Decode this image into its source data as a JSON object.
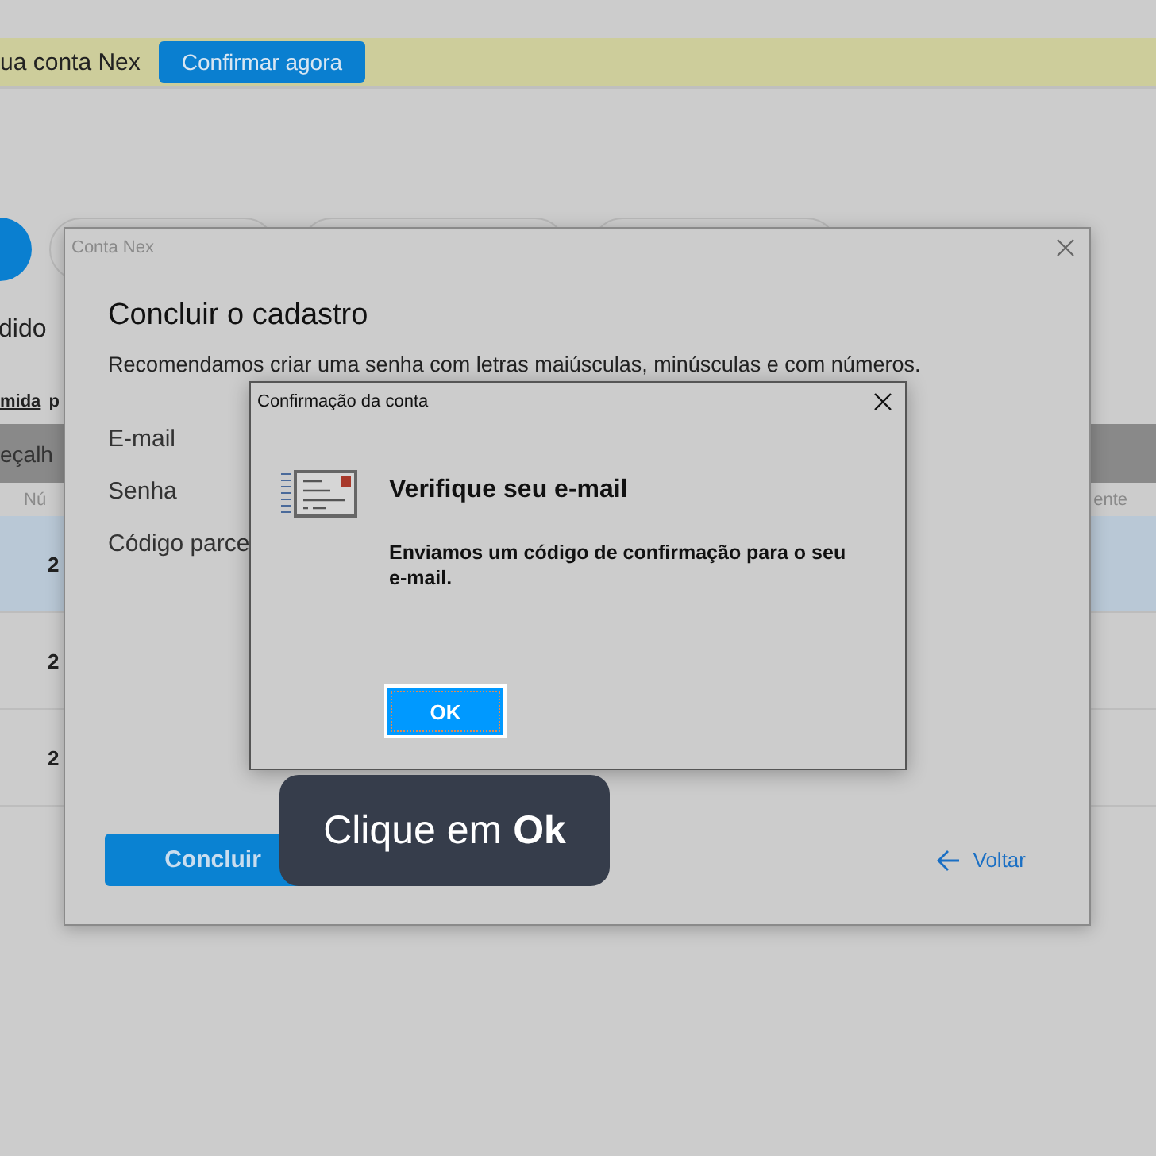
{
  "banner": {
    "text": "ua conta Nex",
    "button": "Confirmar agora"
  },
  "page": {
    "heading": "dido",
    "links": [
      {
        "label": "mida",
        "selected": true
      },
      {
        "label": "p",
        "selected": false
      }
    ],
    "table": {
      "header_bar": "eçalh",
      "columns": [
        "Nú",
        "ente"
      ],
      "rows": [
        {
          "cell": "2",
          "selected": true
        },
        {
          "cell": "2",
          "selected": false
        },
        {
          "cell": "2",
          "selected": false
        }
      ]
    }
  },
  "account_window": {
    "title": "Conta Nex",
    "heading": "Concluir o cadastro",
    "description": "Recomendamos criar uma senha com letras maiúsculas, minúsculas e com números.",
    "fields": [
      "E-mail",
      "Senha",
      "Código parce"
    ],
    "primary_button": "Concluir",
    "back_link": "Voltar"
  },
  "confirm_dialog": {
    "title": "Confirmação da conta",
    "heading": "Verifique seu e-mail",
    "message": "Enviamos um código de confirmação para o seu e-mail.",
    "button": "OK"
  },
  "tooltip": {
    "text": "Clique em **Ok**"
  }
}
